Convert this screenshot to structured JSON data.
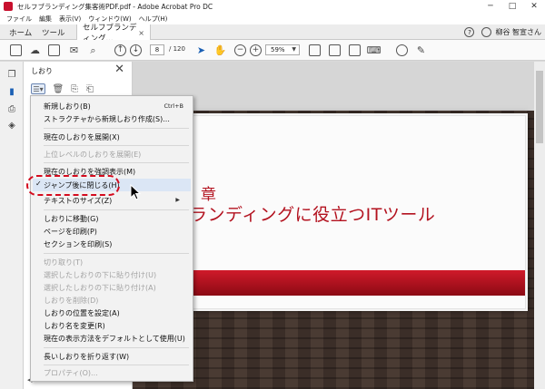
{
  "window": {
    "title": "セルフブランディング集客術PDF.pdf - Adobe Acrobat Pro DC",
    "minimize": "─",
    "maximize": "□",
    "close": "✕"
  },
  "menubar": [
    "ファイル",
    "編集",
    "表示(V)",
    "ウィンドウ(W)",
    "ヘルプ(H)"
  ],
  "tabs": {
    "home": "ホーム",
    "tools": "ツール",
    "doc": "セルフブランディング...",
    "doc_close": "×"
  },
  "user": {
    "name": "柳谷 智宣さん",
    "help": "?"
  },
  "toolbar": {
    "page_current": "8",
    "page_total": "/ 120",
    "zoom": "59%"
  },
  "panel": {
    "title": "しおり",
    "close": "✕"
  },
  "slide": {
    "chapter": "章",
    "title": "ランディングに役立つITツール"
  },
  "context_menu": {
    "items": [
      {
        "label": "新規しおり(B)",
        "shortcut": "Ctrl+B",
        "disabled": false
      },
      {
        "label": "ストラクチャから新規しおり作成(S)...",
        "shortcut": "",
        "disabled": false
      },
      {
        "label": "現在のしおりを展開(X)",
        "shortcut": "",
        "disabled": false
      },
      {
        "label": "上位レベルのしおりを展開(E)",
        "shortcut": "",
        "disabled": true
      },
      {
        "label": "現在のしおりを強調表示(M)",
        "shortcut": "",
        "disabled": false
      },
      {
        "label": "ジャンプ後に閉じる(H)",
        "shortcut": "",
        "disabled": false,
        "checked": true
      },
      {
        "label": "テキストのサイズ(Z)",
        "shortcut": "",
        "disabled": false,
        "submenu": true
      },
      {
        "label": "しおりに移動(G)",
        "shortcut": "",
        "disabled": false
      },
      {
        "label": "ページを印刷(P)",
        "shortcut": "",
        "disabled": false
      },
      {
        "label": "セクションを印刷(S)",
        "shortcut": "",
        "disabled": false
      },
      {
        "label": "切り取り(T)",
        "shortcut": "",
        "disabled": true
      },
      {
        "label": "選択したしおりの下に貼り付け(U)",
        "shortcut": "",
        "disabled": true
      },
      {
        "label": "選択したしおりの下に貼り付け(A)",
        "shortcut": "",
        "disabled": true
      },
      {
        "label": "しおりを削除(D)",
        "shortcut": "",
        "disabled": true
      },
      {
        "label": "しおりの位置を設定(A)",
        "shortcut": "",
        "disabled": false
      },
      {
        "label": "しおり名を変更(R)",
        "shortcut": "",
        "disabled": false
      },
      {
        "label": "現在の表示方法をデフォルトとして使用(U)",
        "shortcut": "",
        "disabled": false
      },
      {
        "label": "長いしおりを折り返す(W)",
        "shortcut": "",
        "disabled": false
      },
      {
        "label": "プロパティ(O)...",
        "shortcut": "",
        "disabled": true
      }
    ],
    "checkmark": "✓",
    "submenu_arrow": "▶"
  }
}
